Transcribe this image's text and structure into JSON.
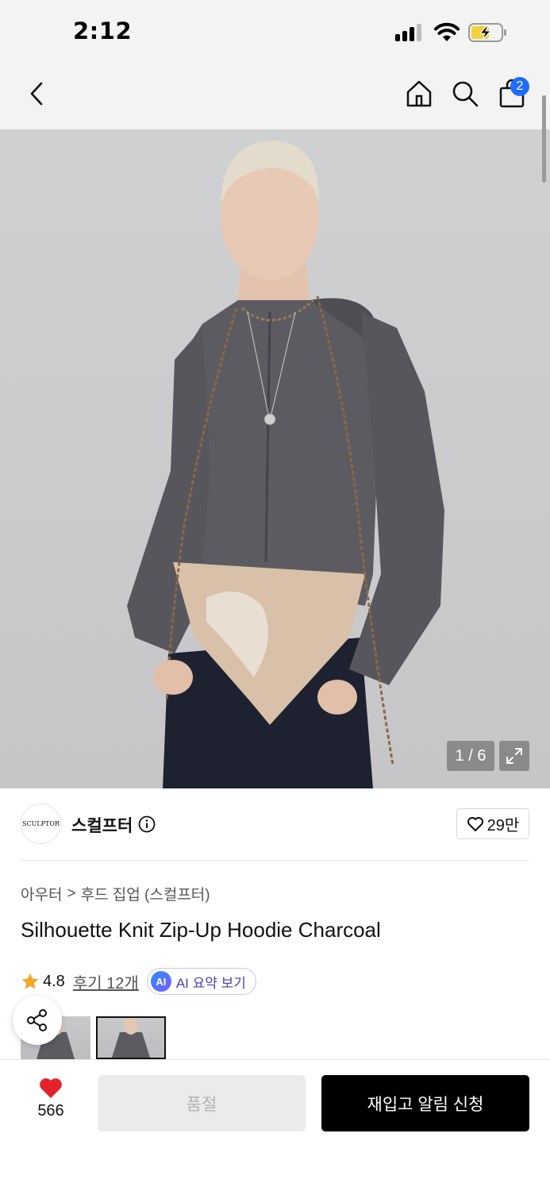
{
  "status_bar": {
    "time": "2:12"
  },
  "nav": {
    "cart_count": "2"
  },
  "gallery": {
    "counter": "1 / 6"
  },
  "brand": {
    "logo_text": "SCULPTOR",
    "name": "스컬프터",
    "followers": "29만"
  },
  "breadcrumb": {
    "category": "아우터",
    "separator": ">",
    "subcategory": "후드 집업 (스컬프터)"
  },
  "product": {
    "title": "Silhouette Knit Zip-Up Hoodie Charcoal",
    "rating": "4.8",
    "reviews_label": "후기 12개",
    "ai_badge": "AI",
    "ai_summary_label": "AI 요약 보기"
  },
  "bottom_bar": {
    "like_count": "566",
    "soldout_label": "품절",
    "restock_label": "재입고 알림 신청"
  },
  "colors": {
    "accent_blue": "#1f6bff",
    "like_red": "#e5212b",
    "rating_star": "#f5a623",
    "restock_bg": "#000000",
    "soldout_bg": "#ebebeb"
  },
  "icons": [
    "back-icon",
    "home-icon",
    "search-icon",
    "shopping-bag-icon",
    "expand-icon",
    "info-icon",
    "heart-outline-icon",
    "star-icon",
    "share-icon",
    "heart-filled-icon"
  ]
}
